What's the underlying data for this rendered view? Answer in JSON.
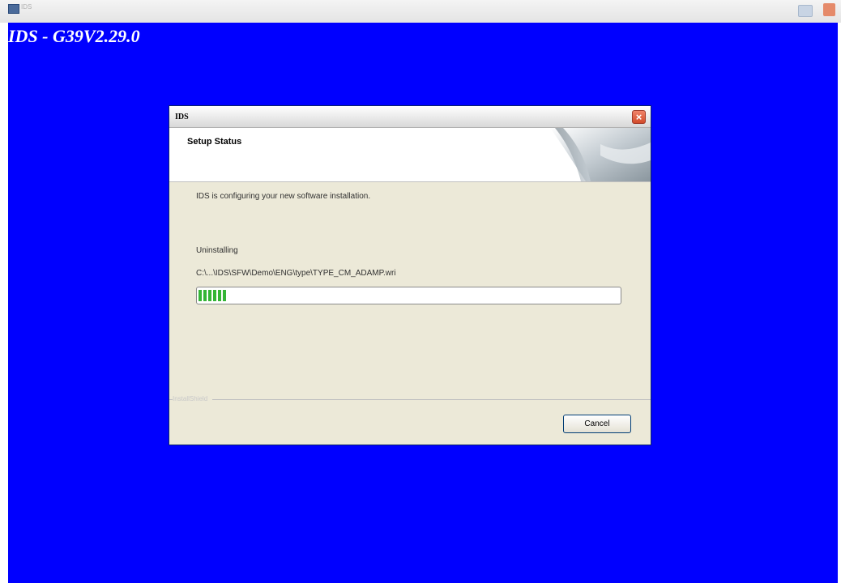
{
  "window": {
    "title": "IDS"
  },
  "product": {
    "title": "IDS - G39V2.29.0"
  },
  "dialog": {
    "title": "IDS",
    "close_glyph": "×",
    "header_title": "Setup Status",
    "body_text": "IDS is configuring your new software installation.",
    "status_label": "Uninstalling",
    "status_path": "C:\\...\\IDS\\SFW\\Demo\\ENG\\type\\TYPE_CM_ADAMP.wri",
    "progress": 0.07,
    "brand_label": "InstallShield",
    "cancel_label": "Cancel"
  },
  "icons": [
    "app-icon",
    "minimize-icon",
    "close-icon",
    "setup-graphic-icon"
  ],
  "colors": {
    "backdrop": "#0000ff",
    "dialog_bg": "#ece9d8",
    "progress": "#34b536",
    "close_button": "#d24a2a"
  }
}
